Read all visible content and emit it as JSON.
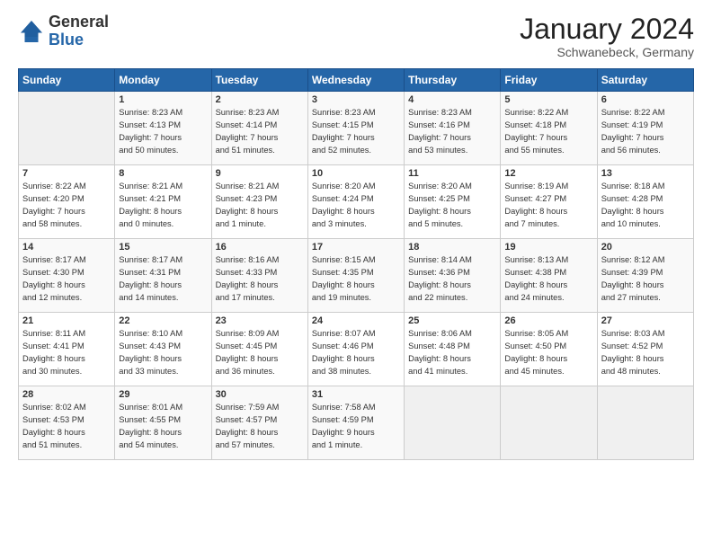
{
  "header": {
    "logo_general": "General",
    "logo_blue": "Blue",
    "month_title": "January 2024",
    "location": "Schwanebeck, Germany"
  },
  "days_of_week": [
    "Sunday",
    "Monday",
    "Tuesday",
    "Wednesday",
    "Thursday",
    "Friday",
    "Saturday"
  ],
  "weeks": [
    [
      {
        "day": "",
        "info": ""
      },
      {
        "day": "1",
        "info": "Sunrise: 8:23 AM\nSunset: 4:13 PM\nDaylight: 7 hours\nand 50 minutes."
      },
      {
        "day": "2",
        "info": "Sunrise: 8:23 AM\nSunset: 4:14 PM\nDaylight: 7 hours\nand 51 minutes."
      },
      {
        "day": "3",
        "info": "Sunrise: 8:23 AM\nSunset: 4:15 PM\nDaylight: 7 hours\nand 52 minutes."
      },
      {
        "day": "4",
        "info": "Sunrise: 8:23 AM\nSunset: 4:16 PM\nDaylight: 7 hours\nand 53 minutes."
      },
      {
        "day": "5",
        "info": "Sunrise: 8:22 AM\nSunset: 4:18 PM\nDaylight: 7 hours\nand 55 minutes."
      },
      {
        "day": "6",
        "info": "Sunrise: 8:22 AM\nSunset: 4:19 PM\nDaylight: 7 hours\nand 56 minutes."
      }
    ],
    [
      {
        "day": "7",
        "info": "Sunrise: 8:22 AM\nSunset: 4:20 PM\nDaylight: 7 hours\nand 58 minutes."
      },
      {
        "day": "8",
        "info": "Sunrise: 8:21 AM\nSunset: 4:21 PM\nDaylight: 8 hours\nand 0 minutes."
      },
      {
        "day": "9",
        "info": "Sunrise: 8:21 AM\nSunset: 4:23 PM\nDaylight: 8 hours\nand 1 minute."
      },
      {
        "day": "10",
        "info": "Sunrise: 8:20 AM\nSunset: 4:24 PM\nDaylight: 8 hours\nand 3 minutes."
      },
      {
        "day": "11",
        "info": "Sunrise: 8:20 AM\nSunset: 4:25 PM\nDaylight: 8 hours\nand 5 minutes."
      },
      {
        "day": "12",
        "info": "Sunrise: 8:19 AM\nSunset: 4:27 PM\nDaylight: 8 hours\nand 7 minutes."
      },
      {
        "day": "13",
        "info": "Sunrise: 8:18 AM\nSunset: 4:28 PM\nDaylight: 8 hours\nand 10 minutes."
      }
    ],
    [
      {
        "day": "14",
        "info": "Sunrise: 8:17 AM\nSunset: 4:30 PM\nDaylight: 8 hours\nand 12 minutes."
      },
      {
        "day": "15",
        "info": "Sunrise: 8:17 AM\nSunset: 4:31 PM\nDaylight: 8 hours\nand 14 minutes."
      },
      {
        "day": "16",
        "info": "Sunrise: 8:16 AM\nSunset: 4:33 PM\nDaylight: 8 hours\nand 17 minutes."
      },
      {
        "day": "17",
        "info": "Sunrise: 8:15 AM\nSunset: 4:35 PM\nDaylight: 8 hours\nand 19 minutes."
      },
      {
        "day": "18",
        "info": "Sunrise: 8:14 AM\nSunset: 4:36 PM\nDaylight: 8 hours\nand 22 minutes."
      },
      {
        "day": "19",
        "info": "Sunrise: 8:13 AM\nSunset: 4:38 PM\nDaylight: 8 hours\nand 24 minutes."
      },
      {
        "day": "20",
        "info": "Sunrise: 8:12 AM\nSunset: 4:39 PM\nDaylight: 8 hours\nand 27 minutes."
      }
    ],
    [
      {
        "day": "21",
        "info": "Sunrise: 8:11 AM\nSunset: 4:41 PM\nDaylight: 8 hours\nand 30 minutes."
      },
      {
        "day": "22",
        "info": "Sunrise: 8:10 AM\nSunset: 4:43 PM\nDaylight: 8 hours\nand 33 minutes."
      },
      {
        "day": "23",
        "info": "Sunrise: 8:09 AM\nSunset: 4:45 PM\nDaylight: 8 hours\nand 36 minutes."
      },
      {
        "day": "24",
        "info": "Sunrise: 8:07 AM\nSunset: 4:46 PM\nDaylight: 8 hours\nand 38 minutes."
      },
      {
        "day": "25",
        "info": "Sunrise: 8:06 AM\nSunset: 4:48 PM\nDaylight: 8 hours\nand 41 minutes."
      },
      {
        "day": "26",
        "info": "Sunrise: 8:05 AM\nSunset: 4:50 PM\nDaylight: 8 hours\nand 45 minutes."
      },
      {
        "day": "27",
        "info": "Sunrise: 8:03 AM\nSunset: 4:52 PM\nDaylight: 8 hours\nand 48 minutes."
      }
    ],
    [
      {
        "day": "28",
        "info": "Sunrise: 8:02 AM\nSunset: 4:53 PM\nDaylight: 8 hours\nand 51 minutes."
      },
      {
        "day": "29",
        "info": "Sunrise: 8:01 AM\nSunset: 4:55 PM\nDaylight: 8 hours\nand 54 minutes."
      },
      {
        "day": "30",
        "info": "Sunrise: 7:59 AM\nSunset: 4:57 PM\nDaylight: 8 hours\nand 57 minutes."
      },
      {
        "day": "31",
        "info": "Sunrise: 7:58 AM\nSunset: 4:59 PM\nDaylight: 9 hours\nand 1 minute."
      },
      {
        "day": "",
        "info": ""
      },
      {
        "day": "",
        "info": ""
      },
      {
        "day": "",
        "info": ""
      }
    ]
  ]
}
